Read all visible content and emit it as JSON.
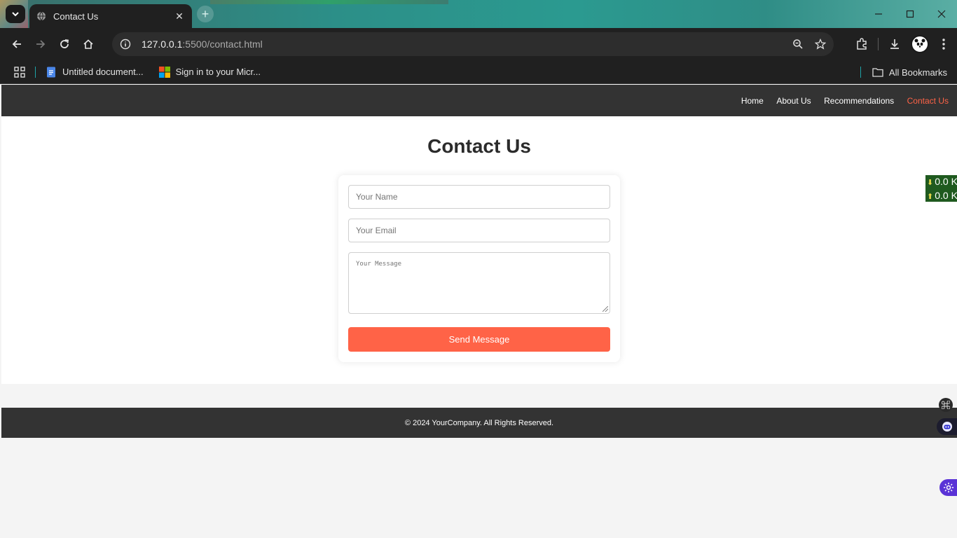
{
  "browser": {
    "tab_title": "Contact Us",
    "url_host": "127.0.0.1",
    "url_rest": ":5500/contact.html",
    "bookmarks": [
      {
        "label": "Untitled document..."
      },
      {
        "label": "Sign in to your Micr..."
      }
    ],
    "all_bookmarks_label": "All Bookmarks"
  },
  "site": {
    "nav": [
      "Home",
      "About Us",
      "Recommendations",
      "Contact Us"
    ],
    "active_nav": "Contact Us",
    "page_title": "Contact Us",
    "form": {
      "name_placeholder": "Your Name",
      "email_placeholder": "Your Email",
      "message_placeholder": "Your Message",
      "submit_label": "Send Message"
    },
    "footer_text": "© 2024 YourCompany. All Rights Reserved."
  },
  "net_widget": {
    "down": "0.0 K",
    "up": "0.0 K"
  },
  "colors": {
    "accent": "#ff6347",
    "header_bg": "#333333"
  }
}
